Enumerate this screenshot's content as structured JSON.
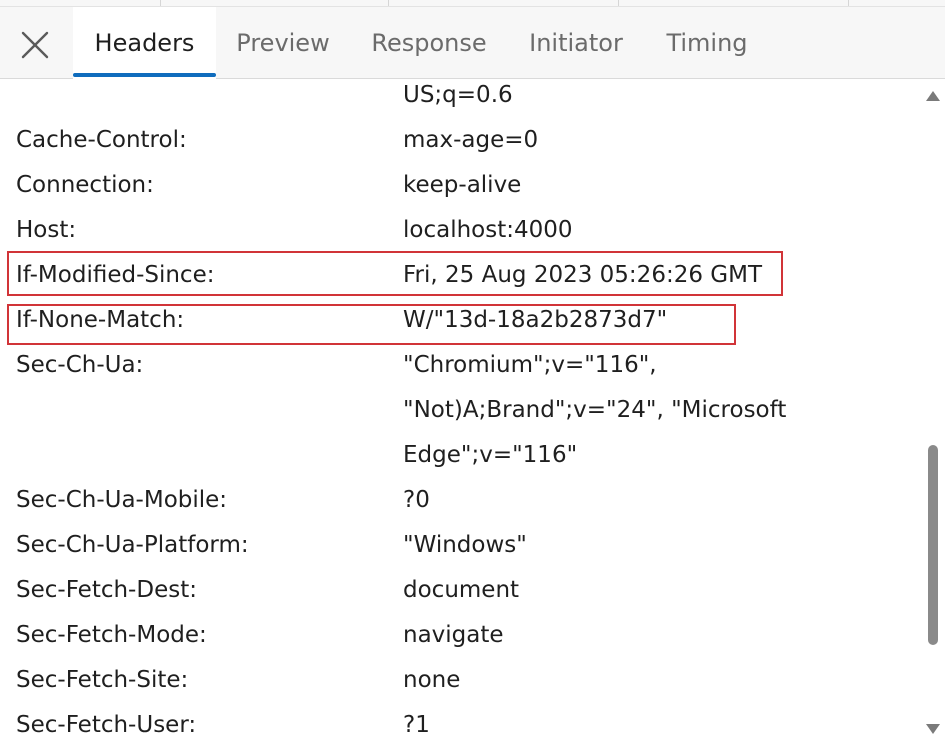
{
  "tabs": [
    {
      "label": "Headers",
      "active": true
    },
    {
      "label": "Preview",
      "active": false
    },
    {
      "label": "Response",
      "active": false
    },
    {
      "label": "Initiator",
      "active": false
    },
    {
      "label": "Timing",
      "active": false
    }
  ],
  "icons": {
    "close": "close-icon",
    "scroll_up": "chevron-up-icon",
    "scroll_down": "chevron-down-icon"
  },
  "colors": {
    "accent": "#0f6cbd",
    "highlight": "#d13438"
  },
  "headers": [
    {
      "name": "",
      "value": "US;q=0.6"
    },
    {
      "name": "Cache-Control:",
      "value": "max-age=0"
    },
    {
      "name": "Connection:",
      "value": "keep-alive"
    },
    {
      "name": "Host:",
      "value": "localhost:4000"
    },
    {
      "name": "If-Modified-Since:",
      "value": "Fri, 25 Aug 2023 05:26:26 GMT",
      "highlighted": true
    },
    {
      "name": "If-None-Match:",
      "value": "W/\"13d-18a2b2873d7\"",
      "highlighted": true
    },
    {
      "name": "Sec-Ch-Ua:",
      "value": "\"Chromium\";v=\"116\",\n\"Not)A;Brand\";v=\"24\", \"Microsoft\nEdge\";v=\"116\""
    },
    {
      "name": "Sec-Ch-Ua-Mobile:",
      "value": "?0"
    },
    {
      "name": "Sec-Ch-Ua-Platform:",
      "value": "\"Windows\""
    },
    {
      "name": "Sec-Fetch-Dest:",
      "value": "document"
    },
    {
      "name": "Sec-Fetch-Mode:",
      "value": "navigate"
    },
    {
      "name": "Sec-Fetch-Site:",
      "value": "none"
    },
    {
      "name": "Sec-Fetch-User:",
      "value": "?1"
    }
  ]
}
